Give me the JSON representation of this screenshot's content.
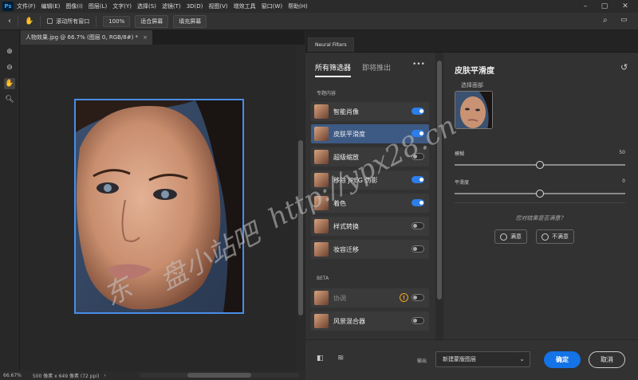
{
  "app": {
    "logo": "Ps"
  },
  "menu": [
    "文件(F)",
    "编辑(E)",
    "图像(I)",
    "图层(L)",
    "文字(Y)",
    "选择(S)",
    "滤镜(T)",
    "3D(D)",
    "视图(V)",
    "增效工具",
    "窗口(W)",
    "帮助(H)"
  ],
  "options": {
    "scroll_all": "滚动所有窗口",
    "zoom": "100%",
    "fit_screen": "适合屏幕",
    "fill_screen": "填充屏幕"
  },
  "document": {
    "tab_title": "人物效果.jpg @ 66.7% (图层 0, RGB/8#) *",
    "close": "×"
  },
  "status": {
    "zoom": "66.67%",
    "info": "500 像素 x 649 像素 (72 ppi)"
  },
  "neural": {
    "panel_tab": "Neural Filters",
    "tabs": [
      "所有筛选器",
      "即将推出"
    ],
    "more": "•••",
    "featured_label": "专题内容",
    "beta_label": "BETA",
    "featured": [
      {
        "label": "智能肖像",
        "on": true
      },
      {
        "label": "皮肤平滑度",
        "on": true,
        "selected": true
      },
      {
        "label": "超级缩放",
        "on": false
      },
      {
        "label": "移除 JPEG 伪影",
        "on": true
      },
      {
        "label": "着色",
        "on": true
      },
      {
        "label": "样式转换",
        "on": false
      },
      {
        "label": "妆容迁移",
        "on": false
      }
    ],
    "beta": [
      {
        "label": "协调",
        "on": false,
        "warning": true
      },
      {
        "label": "风景混合器",
        "on": false
      }
    ]
  },
  "settings": {
    "title": "皮肤平滑度",
    "sublabel": "选择面部",
    "sliders": [
      {
        "label": "模糊",
        "value": 50,
        "min": 0,
        "max": 100
      },
      {
        "label": "平滑度",
        "value": 0,
        "min": -50,
        "max": 50
      }
    ],
    "question": "您对结果是否满意？",
    "satisfied": "满意",
    "unsatisfied": "不满意"
  },
  "bottom": {
    "output_label": "输出",
    "output_value": "新建蒙版图层",
    "ok": "确定",
    "cancel": "取消"
  },
  "watermark": [
    "东",
    "盘小站吧",
    "http://ypx28.cn"
  ],
  "colors": {
    "accent": "#1473e6",
    "selected_row": "#3d5a85",
    "warning": "#f2a51f"
  }
}
